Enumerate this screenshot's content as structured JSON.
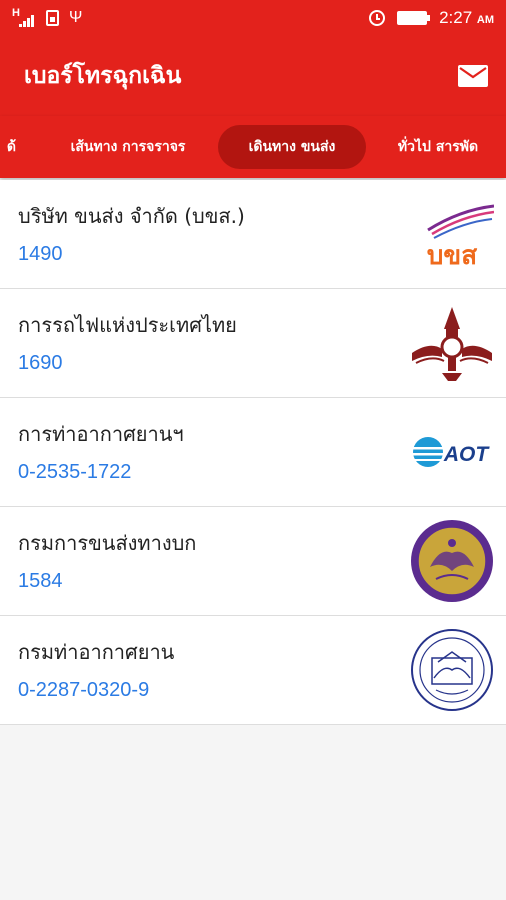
{
  "status_bar": {
    "network": "H",
    "time": "2:27",
    "ampm": "AM"
  },
  "app_bar": {
    "title": "เบอร์โทรฉุกเฉิน",
    "mail_icon": "mail-icon"
  },
  "tabs": [
    {
      "label": "ด้"
    },
    {
      "label": "เส้นทาง การจราจร"
    },
    {
      "label": "เดินทาง ขนส่ง",
      "active": true
    },
    {
      "label": "ทั่วไป สารพัด"
    }
  ],
  "contacts": [
    {
      "name": "บริษัท ขนส่ง จำกัด (บขส.)",
      "phone": "1490",
      "logo": "bks-logo",
      "logo_text": "บขส"
    },
    {
      "name": "การรถไฟแห่งประเทศไทย",
      "phone": "1690",
      "logo": "srt-garuda-logo"
    },
    {
      "name": "การท่าอากาศยานฯ",
      "phone": "0-2535-1722",
      "logo": "aot-logo",
      "logo_text": "AOT"
    },
    {
      "name": "กรมการขนส่งทางบก",
      "phone": "1584",
      "logo": "dlt-seal-logo"
    },
    {
      "name": "กรมท่าอากาศยาน",
      "phone": "0-2287-0320-9",
      "logo": "doa-seal-logo"
    }
  ],
  "colors": {
    "primary": "#e3221c",
    "active_tab": "#b21510",
    "phone": "#2b7be4"
  }
}
